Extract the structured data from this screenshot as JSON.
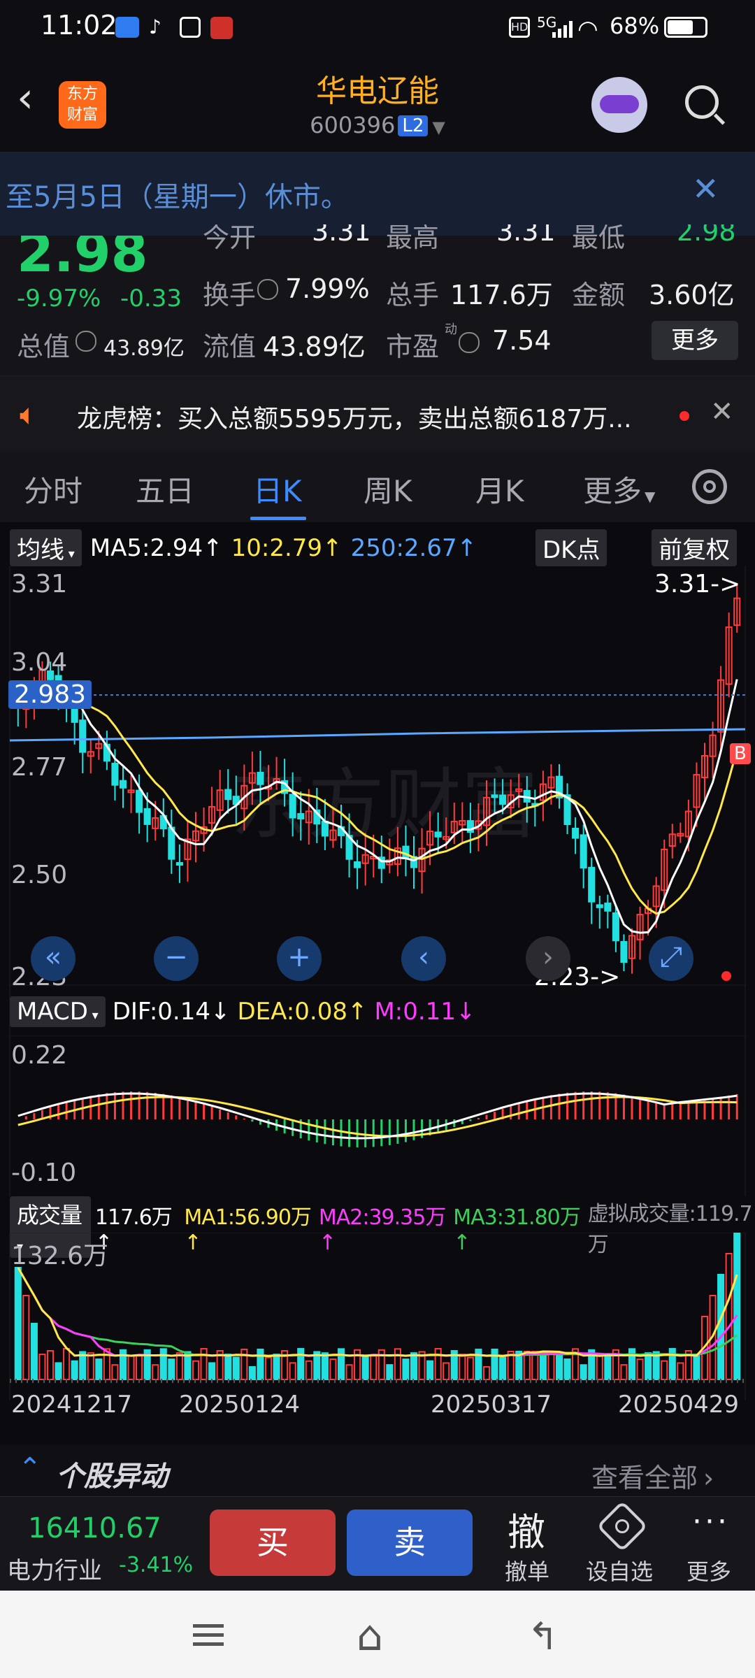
{
  "status": {
    "time": "11:02",
    "network": "5G",
    "battery": "68%"
  },
  "header": {
    "title": "华电辽能",
    "code": "600396",
    "level": "L2"
  },
  "notice": {
    "text": "至5月5日（星期一）休市。"
  },
  "quote": {
    "price": "2.98",
    "change_pct": "-9.97%",
    "change": "-0.33",
    "stats": [
      {
        "label": "今开",
        "value": "3.31"
      },
      {
        "label": "最高",
        "value": "3.31"
      },
      {
        "label": "最低",
        "value": "2.98"
      },
      {
        "label": "换手",
        "value": "7.99%"
      },
      {
        "label": "总手",
        "value": "117.6万"
      },
      {
        "label": "金额",
        "value": "3.60亿"
      },
      {
        "label": "总值",
        "value": "43.89亿"
      },
      {
        "label": "流值",
        "value": "43.89亿"
      },
      {
        "label": "市盈",
        "value": "7.54"
      }
    ],
    "pe_sup": "动",
    "more_label": "更多"
  },
  "dragon": {
    "text": "龙虎榜：买入总额5595万元，卖出总额6187万..."
  },
  "tabs": [
    "分时",
    "五日",
    "日K",
    "周K",
    "月K",
    "更多"
  ],
  "active_tab": 2,
  "kline": {
    "ma_selector": "均线",
    "ma5": "MA5:2.94↑",
    "ma10": "10:2.79↑",
    "ma250": "250:2.67↑",
    "dk_label": "DK点",
    "adjust_label": "前复权",
    "y_labels": [
      "3.31",
      "3.04",
      "2.77",
      "2.50",
      "2.23"
    ],
    "cursor_price": "2.983",
    "high_marker": "3.31->",
    "low_marker": "2.23->",
    "watermark": "东方财富",
    "b_marker": "B"
  },
  "macd": {
    "selector": "MACD",
    "dif": "DIF:0.14↓",
    "dea": "DEA:0.08↑",
    "m": "M:0.11↓",
    "y_top": "0.22",
    "y_bottom": "-0.10"
  },
  "volume": {
    "selector": "成交量",
    "vol": "117.6万↑",
    "ma1": "MA1:56.90万↑",
    "ma2": "MA2:39.35万↑",
    "ma3": "MA3:31.80万↑",
    "virtual": "虚拟成交量:119.7万",
    "y_top": "132.6万",
    "dates": [
      "20241217",
      "20250124",
      "20250317",
      "20250429"
    ]
  },
  "section": {
    "title": "个股异动",
    "link": "查看全部"
  },
  "actionbar": {
    "index_value": "16410.67",
    "industry": "电力行业",
    "industry_change": "-3.41%",
    "buy": "买",
    "sell": "卖",
    "cancel_icon": "撤",
    "cancel_label": "撤单",
    "alert_label": "设自选",
    "more_label": "更多"
  },
  "colors": {
    "up": "#ff3b3b",
    "down": "#22e0e0",
    "ma5": "#ffffff",
    "ma10": "#ffe94a",
    "ma250": "#5aa8ff",
    "accent": "#3c8cff",
    "title": "#ffb020"
  }
}
